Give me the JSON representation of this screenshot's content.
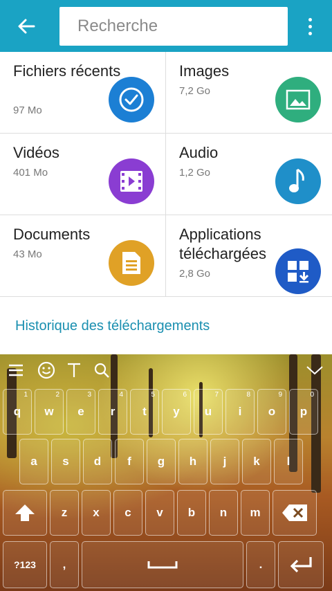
{
  "topbar": {
    "search_placeholder": "Recherche",
    "back_icon": "arrow-left-icon",
    "menu_icon": "more-vert-icon"
  },
  "categories": [
    {
      "title": "Fichiers récents",
      "size": "97 Mo",
      "icon": "clock-check-icon",
      "color": "#1c7fd4"
    },
    {
      "title": "Images",
      "size": "7,2 Go",
      "icon": "image-icon",
      "color": "#2fae7e"
    },
    {
      "title": "Vidéos",
      "size": "401 Mo",
      "icon": "film-icon",
      "color": "#8a3dd2"
    },
    {
      "title": "Audio",
      "size": "1,2 Go",
      "icon": "music-note-icon",
      "color": "#1f8fc9"
    },
    {
      "title": "Documents",
      "size": "43 Mo",
      "icon": "document-icon",
      "color": "#e0a126"
    },
    {
      "title": "Applications téléchargées",
      "size": "2,8 Go",
      "icon": "app-download-icon",
      "color": "#1f5bc6"
    }
  ],
  "history_link": "Historique des téléchargements",
  "keyboard": {
    "row1": [
      {
        "key": "q",
        "hint": "1"
      },
      {
        "key": "w",
        "hint": "2"
      },
      {
        "key": "e",
        "hint": "3"
      },
      {
        "key": "r",
        "hint": "4"
      },
      {
        "key": "t",
        "hint": "5"
      },
      {
        "key": "y",
        "hint": "6"
      },
      {
        "key": "u",
        "hint": "7"
      },
      {
        "key": "i",
        "hint": "8"
      },
      {
        "key": "o",
        "hint": "9"
      },
      {
        "key": "p",
        "hint": "0"
      }
    ],
    "row2": [
      "a",
      "s",
      "d",
      "f",
      "g",
      "h",
      "j",
      "k",
      "l"
    ],
    "row3": [
      "z",
      "x",
      "c",
      "v",
      "b",
      "n",
      "m"
    ],
    "sym_label": "?123",
    "comma_label": ",",
    "period_label": "."
  }
}
